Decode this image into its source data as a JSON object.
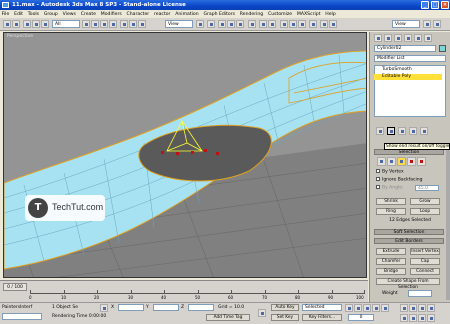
{
  "window": {
    "title": "11.max - Autodesk 3ds Max 8 SP3  - Stand-alone License"
  },
  "menu": [
    "File",
    "Edit",
    "Tools",
    "Group",
    "Views",
    "Create",
    "Modifiers",
    "Character",
    "reactor",
    "Animation",
    "Graph Editors",
    "Rendering",
    "Customize",
    "MAXScript",
    "Help"
  ],
  "toolbar": {
    "filter": "All",
    "refcoord": "View"
  },
  "viewport": {
    "label": "Perspective"
  },
  "logo": {
    "text": "TechTut.com",
    "icon": "T"
  },
  "panel": {
    "object_name": "Cylinder02",
    "modifier_list": "Modifier List",
    "stack": [
      "TurboSmooth",
      "Editable Poly"
    ],
    "tooltip": "Show end result on/off toggle",
    "selection_title": "Selection",
    "by_vertex": "By Vertex",
    "ignore_backfacing": "Ignore Backfacing",
    "by_angle": "By Angle:",
    "angle_value": "45.0",
    "shrink": "Shrink",
    "grow": "Grow",
    "ring": "Ring",
    "loop": "Loop",
    "selected_count": "12 Edges Selected",
    "soft_selection": "Soft Selection",
    "edit_edges": "Edit Borders",
    "extrude": "Extrude",
    "insert_vertex": "Insert Vertex",
    "chamfer": "Chamfer",
    "cap": "Cap",
    "bridge": "Bridge",
    "connect": "Connect",
    "create_shape": "Create Shape From Selection",
    "weight": "Weight"
  },
  "timeline": {
    "slider": "0 / 100",
    "ticks": [
      "0",
      "10",
      "20",
      "30",
      "40",
      "50",
      "60",
      "70",
      "80",
      "90",
      "100"
    ]
  },
  "status": {
    "selected": "1 Object Se",
    "script_label": "PaintersInterf",
    "rendering_time": "Rendering Time  0:00:00",
    "grid": "Grid = 10.0",
    "add_time_tag": "Add Time Tag",
    "auto_key": "Auto Key",
    "set_key": "Set Key",
    "selected_mode": "Selected",
    "key_filters": "Key Filters...",
    "frame": "0"
  },
  "colors": {
    "mesh": "#a6e2f2",
    "edge_sel": "#e0a020",
    "accent": "#0a46c8"
  }
}
